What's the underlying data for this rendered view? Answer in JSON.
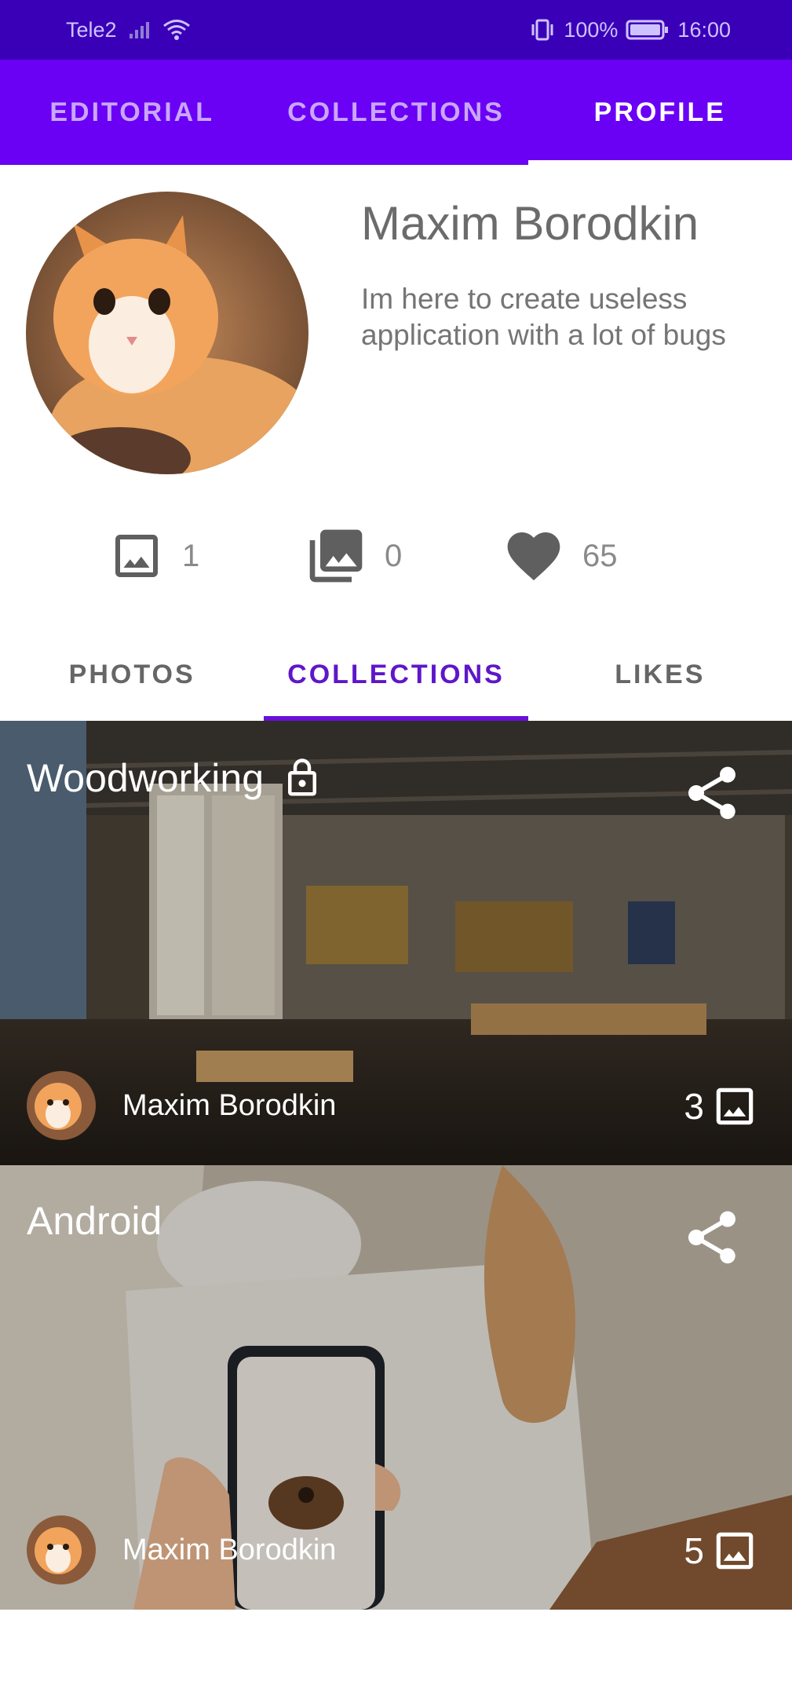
{
  "status_bar": {
    "carrier": "Tele2",
    "battery": "100%",
    "time": "16:00"
  },
  "top_tabs": [
    {
      "label": "EDITORIAL",
      "active": false
    },
    {
      "label": "COLLECTIONS",
      "active": false
    },
    {
      "label": "PROFILE",
      "active": true
    }
  ],
  "profile": {
    "name": "Maxim Borodkin",
    "bio": "Im here to create useless application with a lot of bugs",
    "avatar": "cat-avatar-image"
  },
  "stats": {
    "photos": "1",
    "collections": "0",
    "likes": "65"
  },
  "sub_tabs": [
    {
      "label": "PHOTOS",
      "active": false
    },
    {
      "label": "COLLECTIONS",
      "active": true
    },
    {
      "label": "LIKES",
      "active": false
    }
  ],
  "collections": [
    {
      "title": "Woodworking",
      "private": true,
      "author": "Maxim Borodkin",
      "count": "3",
      "cover": "workshop-photo"
    },
    {
      "title": "Android",
      "private": false,
      "author": "Maxim Borodkin",
      "count": "5",
      "cover": "phone-and-wood-figure-photo"
    }
  ],
  "colors": {
    "status_bar": "#3a00b8",
    "app_bar": "#6a00f4",
    "accent": "#5f16c9"
  },
  "icons": {
    "stat_photos": "image-icon",
    "stat_collections": "photo-library-icon",
    "stat_likes": "heart-icon",
    "share": "share-icon",
    "lock": "lock-icon",
    "count": "image-icon"
  }
}
